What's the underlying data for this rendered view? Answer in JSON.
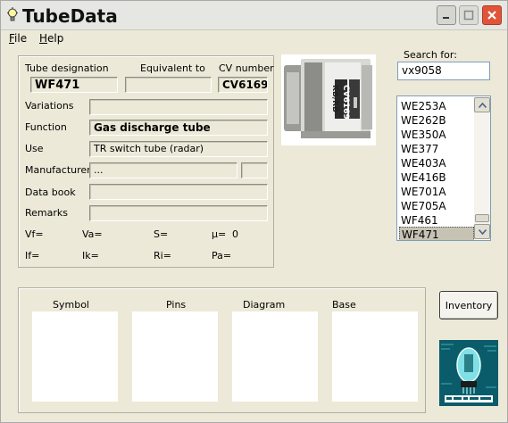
{
  "window": {
    "title": "TubeData"
  },
  "menu": {
    "file": "File",
    "help": "Help"
  },
  "details": {
    "labels": {
      "tube_designation": "Tube designation",
      "equivalent_to": "Equivalent to",
      "cv_number": "CV number",
      "variations": "Variations",
      "function": "Function",
      "use": "Use",
      "manufacturer": "Manufacturer",
      "data_book": "Data book",
      "remarks": "Remarks"
    },
    "values": {
      "tube_designation": "WF471",
      "equivalent_to": "",
      "cv_number": "CV6169",
      "variations": "",
      "function": "Gas discharge tube",
      "use": "TR switch tube (radar)",
      "manufacturer": "...",
      "manufacturer_code": "",
      "data_book": "",
      "remarks": ""
    },
    "params": {
      "vf": "Vf=",
      "va": "Va=",
      "s": "S=",
      "mu": "µ=",
      "mu_value": "0",
      "if": "If=",
      "ik": "Ik=",
      "ri": "Ri=",
      "pa": "Pa="
    }
  },
  "photo": {
    "label_1": "CV6169",
    "label_2": "KB/RB"
  },
  "search": {
    "label": "Search for:",
    "value": "vx9058",
    "results": [
      "WE253A",
      "WE262B",
      "WE350A",
      "WE377",
      "WE403A",
      "WE416B",
      "WE701A",
      "WE705A",
      "WF461",
      "WF471"
    ],
    "selected": "WF471"
  },
  "panels": {
    "symbol": "Symbol",
    "pins": "Pins",
    "diagram": "Diagram",
    "base": "Base"
  },
  "buttons": {
    "inventory": "Inventory"
  },
  "colors": {
    "title_bar": "#e6e6e2",
    "window_bg": "#ece9d8",
    "close_button": "#e0543a",
    "list_selection": "#c6c3b5",
    "logo_bg": "#0a5c6a"
  }
}
